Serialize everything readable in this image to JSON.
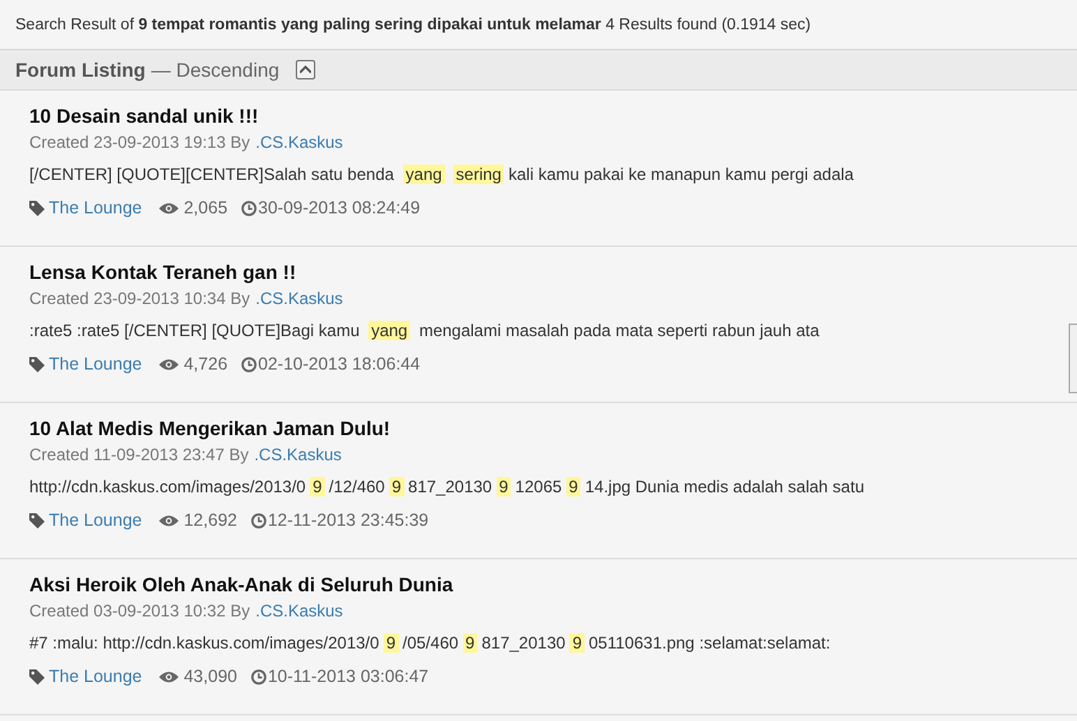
{
  "search_summary": "Search Result of **9 tempat romantis yang paling sering dipakai untuk melamar** 4 Results found (0.1914 sec)",
  "listing": {
    "title": "Forum Listing",
    "order": "— Descending"
  },
  "threads": [
    {
      "title": "10 Desain sandal unik !!!",
      "created": "Created 23-09-2013 19:13 By",
      "author": ".CS.Kaskus",
      "snippet": [
        {
          "text": "[/CENTER] [QUOTE][CENTER]Salah satu benda ",
          "highlight": false
        },
        {
          "text": "yang",
          "highlight": true
        },
        {
          "text": "sering",
          "highlight": true
        },
        {
          "text": "kali kamu pakai ke manapun kamu pergi adala",
          "highlight": false
        }
      ],
      "forum": "The Lounge",
      "views": "2,065",
      "last_post": "30-09-2013 08:24:49"
    },
    {
      "title": "Lensa Kontak Teraneh gan !!",
      "created": "Created 23-09-2013 10:34 By",
      "author": ".CS.Kaskus",
      "snippet": [
        {
          "text": ":rate5 :rate5 [/CENTER] [QUOTE]Bagi kamu ",
          "highlight": false
        },
        {
          "text": "yang",
          "highlight": true
        },
        {
          "text": " mengalami masalah pada mata seperti rabun jauh ata",
          "highlight": false
        }
      ],
      "forum": "The Lounge",
      "views": "4,726",
      "last_post": "02-10-2013 18:06:44"
    },
    {
      "title": "10 Alat Medis Mengerikan Jaman Dulu!",
      "created": "Created 11-09-2013 23:47 By",
      "author": ".CS.Kaskus",
      "snippet": [
        {
          "text": "http://cdn.kaskus.com/images/2013/0",
          "highlight": false
        },
        {
          "text": "9",
          "highlight": true
        },
        {
          "text": "/12/460",
          "highlight": false
        },
        {
          "text": "9",
          "highlight": true
        },
        {
          "text": "817_20130",
          "highlight": false
        },
        {
          "text": "9",
          "highlight": true
        },
        {
          "text": "12065",
          "highlight": false
        },
        {
          "text": "9",
          "highlight": true
        },
        {
          "text": "14.jpg Dunia medis adalah salah satu",
          "highlight": false
        }
      ],
      "forum": "The Lounge",
      "views": "12,692",
      "last_post": "12-11-2013 23:45:39"
    },
    {
      "title": "Aksi Heroik Oleh Anak-Anak di Seluruh Dunia",
      "created": "Created 03-09-2013 10:32 By",
      "author": ".CS.Kaskus",
      "snippet": [
        {
          "text": "#7 :malu: http://cdn.kaskus.com/images/2013/0",
          "highlight": false
        },
        {
          "text": "9",
          "highlight": true
        },
        {
          "text": "/05/460",
          "highlight": false
        },
        {
          "text": "9",
          "highlight": true
        },
        {
          "text": "817_20130",
          "highlight": false
        },
        {
          "text": "9",
          "highlight": true
        },
        {
          "text": "05110631.png :selamat:selamat:",
          "highlight": false
        }
      ],
      "forum": "The Lounge",
      "views": "43,090",
      "last_post": "10-11-2013 03:06:47"
    }
  ]
}
